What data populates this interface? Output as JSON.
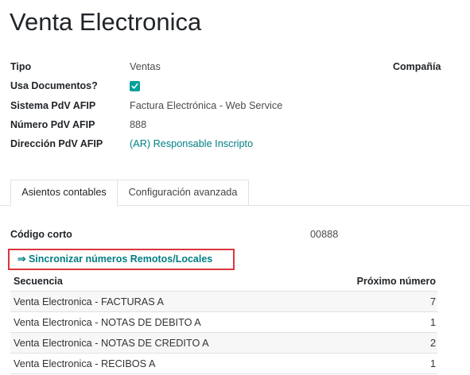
{
  "record": {
    "title": "Venta Electronica"
  },
  "fields": {
    "tipo": {
      "label": "Tipo",
      "value": "Ventas"
    },
    "usa_documentos": {
      "label": "Usa Documentos?",
      "checked": true
    },
    "sistema_pdv_afip": {
      "label": "Sistema PdV AFIP",
      "value": "Factura Electrónica - Web Service"
    },
    "numero_pdv_afip": {
      "label": "Número PdV AFIP",
      "value": "888"
    },
    "direccion_pdv_afip": {
      "label": "Dirección PdV AFIP",
      "value": "(AR) Responsable Inscripto"
    },
    "compania": {
      "label": "Compañía"
    }
  },
  "tabs": [
    {
      "label": "Asientos contables",
      "active": true
    },
    {
      "label": "Configuración avanzada",
      "active": false
    }
  ],
  "asientos_contables": {
    "codigo_corto": {
      "label": "Código corto",
      "value": "00888"
    },
    "sync_link": {
      "label": "⇒ Sincronizar números Remotos/Locales",
      "highlighted": true
    },
    "secuencias": {
      "columns": {
        "secuencia": "Secuencia",
        "proximo_numero": "Próximo número"
      },
      "rows": [
        {
          "secuencia": "Venta Electronica - FACTURAS A",
          "proximo_numero": 7
        },
        {
          "secuencia": "Venta Electronica - NOTAS DE DEBITO A",
          "proximo_numero": 1
        },
        {
          "secuencia": "Venta Electronica - NOTAS DE CREDITO A",
          "proximo_numero": 2
        },
        {
          "secuencia": "Venta Electronica - RECIBOS A",
          "proximo_numero": 1
        }
      ]
    }
  },
  "colors": {
    "link": "#017e84",
    "checkbox": "#00a09d",
    "highlight": "#d9363e",
    "text": "#212529"
  }
}
